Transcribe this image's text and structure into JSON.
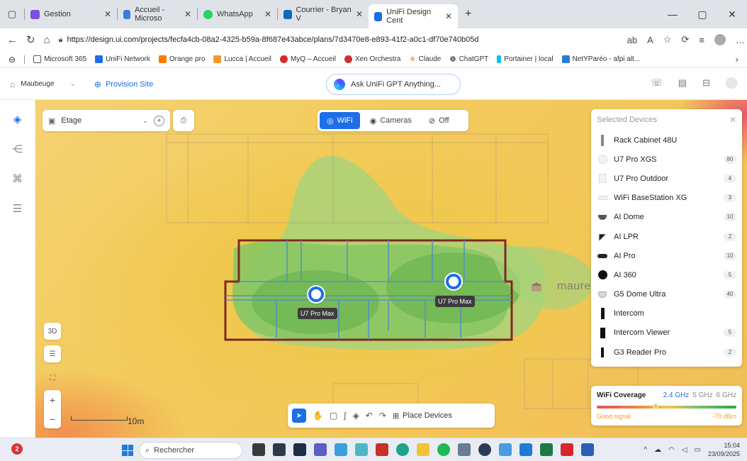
{
  "browser": {
    "tabs": [
      {
        "label": "Gestion",
        "color": "#7b4fe0",
        "active": false
      },
      {
        "label": "Accueil - Microso",
        "color": "#3b7ae0",
        "active": false
      },
      {
        "label": "WhatsApp",
        "color": "#25d366",
        "active": false
      },
      {
        "label": "Courrier - Bryan V",
        "color": "#0f6cbd",
        "active": false
      },
      {
        "label": "UniFi Design Cent",
        "color": "#1c6fe8",
        "active": true
      }
    ],
    "new_tab": "+",
    "url": "https://design.ui.com/projects/fecfa4cb-08a2-4325-b59a-8f687e43abce/plans/7d3470e8-e893-41f2-a0c1-df70e740b05d",
    "bookmarks": [
      {
        "label": "Microsoft 365",
        "color": "#555555"
      },
      {
        "label": "UniFi Network",
        "color": "#1c6fe8"
      },
      {
        "label": "Orange pro",
        "color": "#ff7900"
      },
      {
        "label": "Lucca | Accueil",
        "color": "#f29a2e"
      },
      {
        "label": "MyQ – Accueil",
        "color": "#d42a2a"
      },
      {
        "label": "Xen Orchestra",
        "color": "#d03030"
      },
      {
        "label": "Claude",
        "color": "#d97757"
      },
      {
        "label": "ChatGPT",
        "color": "#333333"
      },
      {
        "label": "Portainer | local",
        "color": "#13bef9"
      },
      {
        "label": "NetYParéo - afpi alt...",
        "color": "#2a7bd8"
      }
    ]
  },
  "header": {
    "site": "Maubeuge",
    "provision": "Provision Site",
    "ask_gpt": "Ask UniFi GPT Anything..."
  },
  "canvas": {
    "floor": "Etage",
    "modes": [
      "WiFi",
      "Cameras",
      "Off"
    ],
    "active_mode": "WiFi",
    "access_points": [
      {
        "label": "U7 Pro Max"
      },
      {
        "label": "U7 Pro Max"
      }
    ],
    "logo_text": "maure",
    "view_3d": "3D",
    "scale": "10m",
    "place_devices": "Place Devices"
  },
  "devices_panel": {
    "title": "Selected Devices",
    "items": [
      {
        "name": "Rack Cabinet 48U",
        "count": ""
      },
      {
        "name": "U7 Pro XGS",
        "count": "80"
      },
      {
        "name": "U7 Pro Outdoor",
        "count": "4"
      },
      {
        "name": "WiFi BaseStation XG",
        "count": "3"
      },
      {
        "name": "AI Dome",
        "count": "10"
      },
      {
        "name": "AI LPR",
        "count": "2"
      },
      {
        "name": "AI Pro",
        "count": "10"
      },
      {
        "name": "AI 360",
        "count": "5"
      },
      {
        "name": "G5 Dome Ultra",
        "count": "40"
      },
      {
        "name": "Intercom",
        "count": ""
      },
      {
        "name": "Intercom Viewer",
        "count": "5"
      },
      {
        "name": "G3 Reader Pro",
        "count": "2"
      }
    ]
  },
  "coverage": {
    "title": "WiFi Coverage",
    "bands": [
      "2.4 GHz",
      "5 GHz",
      "6 GHz"
    ],
    "active_band": "2.4 GHz",
    "signal_label": "Good signal",
    "dbm": "-70 dBm",
    "level": 0.42
  },
  "taskbar": {
    "notifications": "2",
    "search": "Rechercher",
    "time": "15:04",
    "date": "23/09/2025"
  }
}
